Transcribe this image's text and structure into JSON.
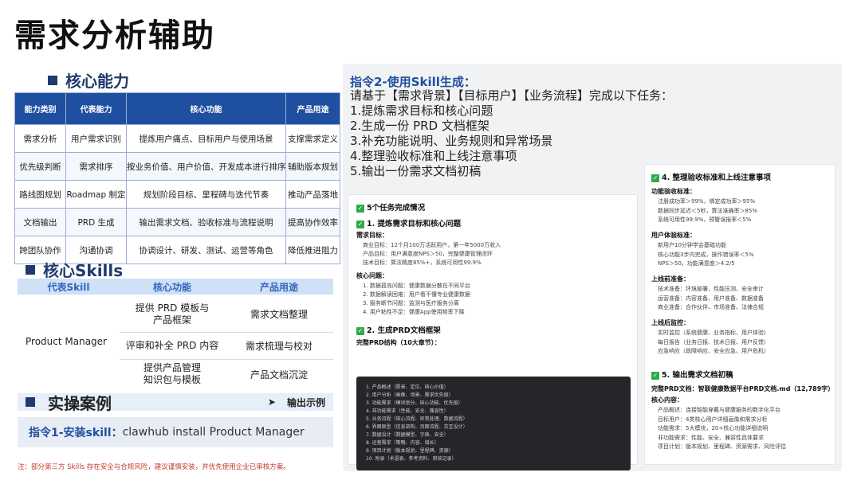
{
  "page_title": "需求分析辅助",
  "section_core_ability": "核心能力",
  "capability_table": {
    "headers": [
      "能力类别",
      "代表能力",
      "核心功能",
      "产品用途"
    ],
    "rows": [
      [
        "需求分析",
        "用户需求识别",
        "提炼用户痛点、目标用户与使用场景",
        "支撑需求定义"
      ],
      [
        "优先级判断",
        "需求排序",
        "按业务价值、用户价值、开发成本进行排序",
        "辅助版本规划"
      ],
      [
        "路线图规划",
        "Roadmap 制定",
        "规划阶段目标、里程碑与迭代节奏",
        "推动产品落地"
      ],
      [
        "文档输出",
        "PRD 生成",
        "输出需求文档、验收标准与流程说明",
        "提高协作效率"
      ],
      [
        "跨团队协作",
        "沟通协调",
        "协调设计、研发、测试、运营等角色",
        "降低推进阻力"
      ]
    ]
  },
  "section_skills": "核心Skills",
  "skills_table": {
    "headers": [
      "代表Skill",
      "核心功能",
      "产品用途"
    ],
    "skill_name": "Product Manager",
    "rows": [
      {
        "func": "提供 PRD 模板与\n产品框架",
        "use": "需求文档整理"
      },
      {
        "func": "评审和补全 PRD 内容",
        "use": "需求梳理与校对"
      },
      {
        "func": "提供产品管理\n知识包与模板",
        "use": "产品文档沉淀"
      }
    ]
  },
  "section_cases": "实操案例",
  "output_example": "输出示例",
  "command1": {
    "label": "指令1-安装skill：",
    "code": "clawhub install Product Manager"
  },
  "footnote": "注：部分第三方 Skills 存在安全与合规风险，建议谨慎安装，并优先使用企业已审核方案。",
  "right_panel": {
    "title": "指令2-使用Skill生成：",
    "tasks": [
      "请基于【需求背景】【目标用户】【业务流程】完成以下任务：",
      "1.提炼需求目标和核心问题",
      "2.生成一份 PRD 文档框架",
      "3.补充功能说明、业务规则和异常场景",
      "4.整理验收标准和上线注意事项",
      "5.输出一份需求文档初稿"
    ]
  },
  "card_left": {
    "header": "5个任务完成情况",
    "s1_title": "1. 提炼需求目标和核心问题",
    "s1_goals_label": "需求目标：",
    "s1_goals": [
      "商业目标：12个月100万活跃用户，第一年5000万收入",
      "产品目标：用户满意度NPS＞50，完整健康管理闭环",
      "技术目标：算法精度85%+，系统可用性99.9%"
    ],
    "s1_issues_label": "核心问题：",
    "s1_issues": [
      "1. 数据孤岛问题：健康数据分散在不同平台",
      "2. 数据解读困难：用户看不懂专业健康数据",
      "3. 服务断节问题：监测与医疗服务分离",
      "4. 用户粘性不足：健康App使用频率下降"
    ],
    "s2_title": "2. 生成PRD文档框架",
    "s2_structure": "完整PRD结构（10大章节）：",
    "code_lines": [
      "1. 产品概述（愿景、定位、核心价值）",
      "2. 用户分析（画像、场景、需求优先级）",
      "3. 功能需求（模块划分、核心功能、优先级）",
      "4. 非功能需求（性能、安全、兼容性）",
      "5. 业务流程（核心流程、异常处理、数据流程）",
      "6. 界面原型（信息架构、页面流程、交互设计）",
      "7. 数据设计（数据模型、字典、安全）",
      "8. 运营需求（策略、内容、增长）",
      "9. 项目计划（版本规划、里程碑、资源）",
      "10. 附录（术语表、参考资料、审核记录）"
    ]
  },
  "card_right": {
    "s4_title": "4. 整理验收标准和上线注意事项",
    "func_label": "功能验收标准：",
    "func_items": [
      "注册成功率＞99%，绑定成功率＞95%",
      "数据同步延迟＜5秒，算法准确率＞85%",
      "系统可用性99.9%，预警误报率＜5%"
    ],
    "ux_label": "用户体验标准：",
    "ux_items": [
      "新用户10分钟学会基础功能",
      "核心功能3步内完成，操作错误率＜5%",
      "NPS＞50，功能满意度＞4.2/5"
    ],
    "pre_label": "上线前准备：",
    "pre_items": [
      "技术准备：环境部署、性能压测、安全审计",
      "运营准备：内容准备、用户准备、数据准备",
      "商业准备：合作伙伴、市场准备、法律合规"
    ],
    "post_label": "上线后监控：",
    "post_items": [
      "实时监控（系统健康、业务指标、用户体验）",
      "每日报告（业务日报、技术日报、用户反馈）",
      "应急响应（故障响应、安全应急、用户危机）"
    ],
    "s5_title": "5. 输出需求文档初稿",
    "s5_doc": "完整PRD文档：智联健康数据平台PRD文档.md（12,789字）",
    "s5_content_label": "核心内容：",
    "s5_items": [
      "产品概述：连接智能穿戴与健康服务的数字化平台",
      "目标用户：4类核心用户详细画像和需求分析",
      "功能需求：5大模块，20+核心功能详细说明",
      "非功能需求：性能、安全、兼容性具体要求",
      "项目计划：版本规划、里程碑、资源需求、风险评估"
    ]
  }
}
